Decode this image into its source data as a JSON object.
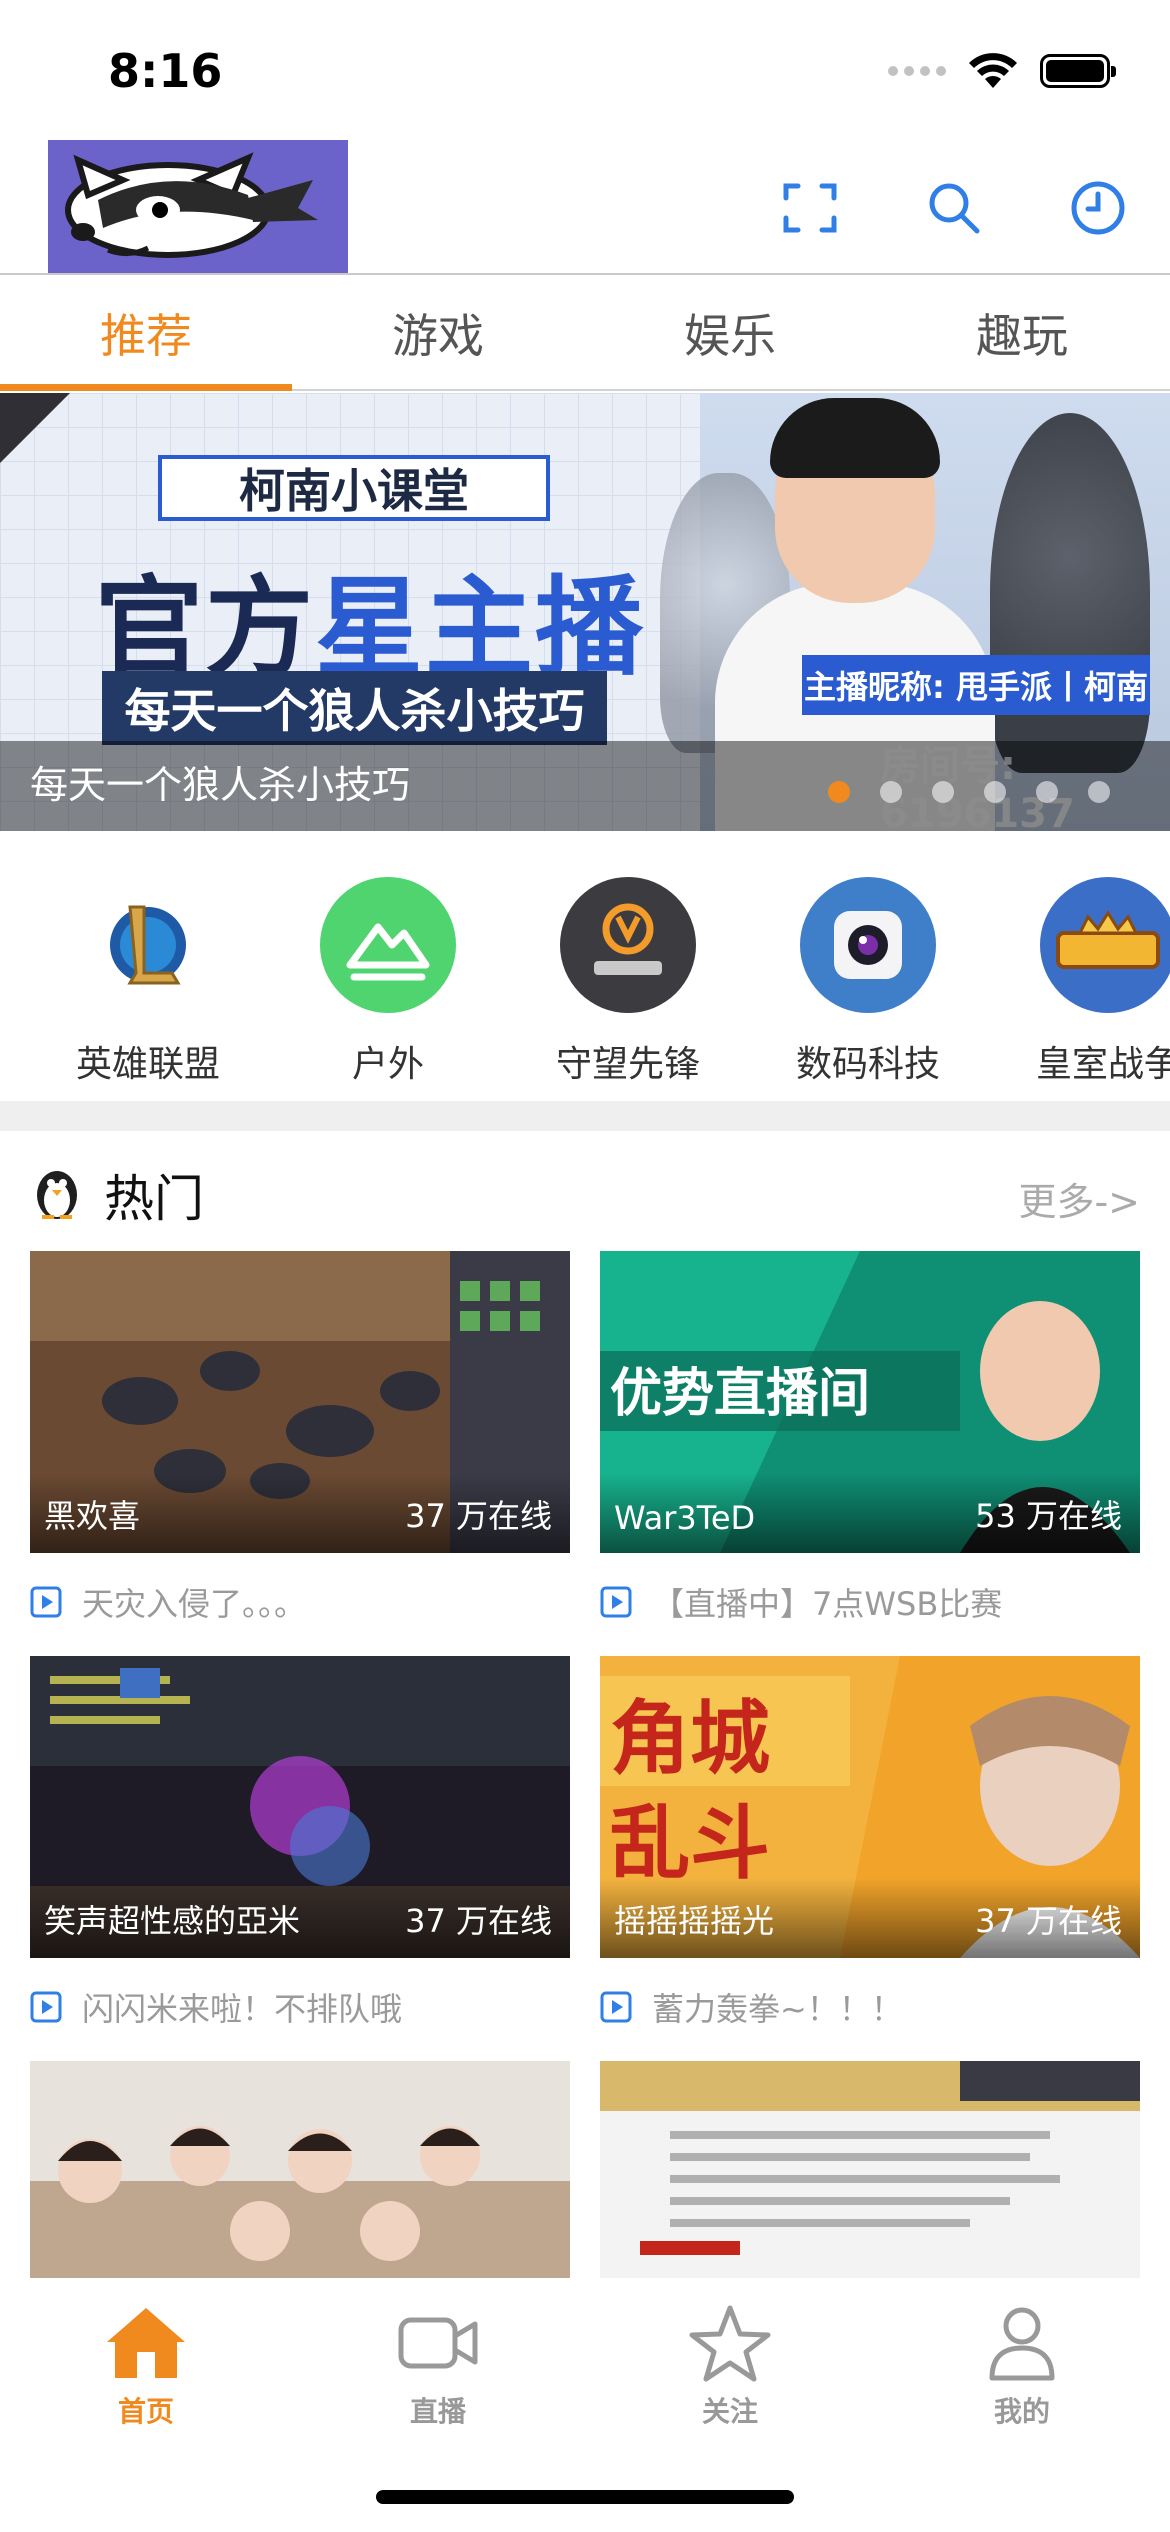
{
  "status_bar": {
    "time": "8:16"
  },
  "navbar": {
    "logo": "logo"
  },
  "tabs": [
    {
      "label": "推荐",
      "active": true
    },
    {
      "label": "游戏",
      "active": false
    },
    {
      "label": "娱乐",
      "active": false
    },
    {
      "label": "趣玩",
      "active": false
    }
  ],
  "banner": {
    "label": "柯南小课堂",
    "title_a": "官方",
    "title_b": "星主播",
    "subtitle": "每天一个狼人杀小技巧",
    "tag": "主播昵称: 甩手派丨柯南",
    "room": "房间号: 6196137",
    "caption": "每天一个狼人杀小技巧",
    "page_count": 6,
    "active_page": 1
  },
  "categories": [
    {
      "label": "英雄联盟",
      "icon": "league-of-legends-icon"
    },
    {
      "label": "户外",
      "icon": "outdoor-mountain-icon"
    },
    {
      "label": "守望先锋",
      "icon": "overwatch-icon"
    },
    {
      "label": "数码科技",
      "icon": "camera-icon"
    },
    {
      "label": "皇室战争",
      "icon": "clash-royale-icon"
    }
  ],
  "hot": {
    "title": "热门",
    "more": "更多->",
    "cards": [
      {
        "name": "黑欢喜",
        "count": "37 万在线",
        "title": "天灾入侵了。。。"
      },
      {
        "name": "War3TeD",
        "count": "53 万在线",
        "title": "【直播中】7点WSB比赛"
      },
      {
        "name": "笑声超性感的亞米",
        "count": "37 万在线",
        "title": "闪闪米来啦！不排队哦"
      },
      {
        "name": "摇摇摇摇光",
        "count": "37 万在线",
        "title": "蓄力轰拳~！！！"
      }
    ]
  },
  "tabbar": [
    {
      "label": "首页",
      "icon": "home-icon",
      "active": true
    },
    {
      "label": "直播",
      "icon": "video-camera-icon",
      "active": false
    },
    {
      "label": "关注",
      "icon": "star-icon",
      "active": false
    },
    {
      "label": "我的",
      "icon": "person-icon",
      "active": false
    }
  ],
  "colors": {
    "accent": "#f08a1f",
    "link_blue": "#2f7fe6"
  }
}
